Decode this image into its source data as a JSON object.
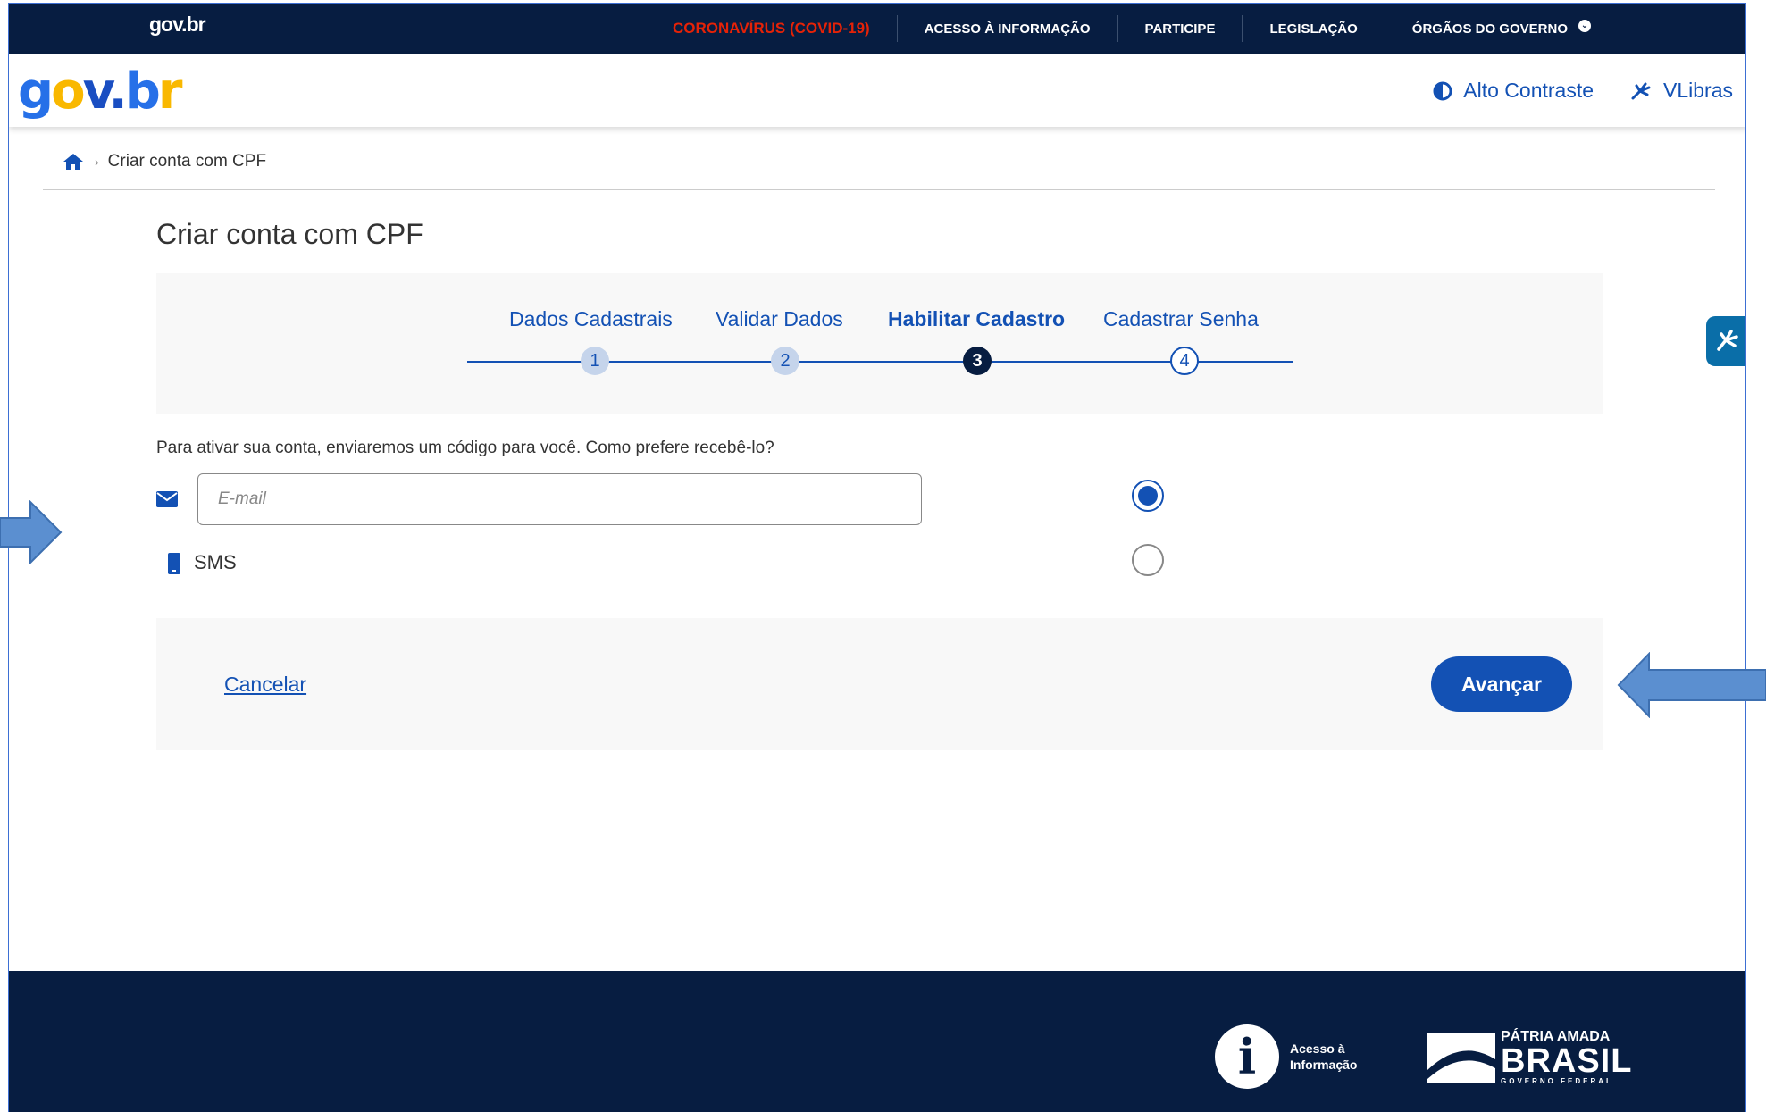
{
  "topbar": {
    "brand": "gov.br",
    "nav": [
      "CORONAVÍRUS (COVID-19)",
      "ACESSO À INFORMAÇÃO",
      "PARTICIPE",
      "LEGISLAÇÃO",
      "ÓRGÃOS DO GOVERNO"
    ]
  },
  "header": {
    "logo": "gov.br",
    "high_contrast": "Alto Contraste",
    "vlibras": "VLibras"
  },
  "breadcrumb": {
    "current": "Criar conta com CPF"
  },
  "page": {
    "title": "Criar conta com CPF",
    "steps": [
      {
        "label": "Dados Cadastrais",
        "number": "1",
        "state": "done"
      },
      {
        "label": "Validar Dados",
        "number": "2",
        "state": "done"
      },
      {
        "label": "Habilitar Cadastro",
        "number": "3",
        "state": "current"
      },
      {
        "label": "Cadastrar Senha",
        "number": "4",
        "state": "todo"
      }
    ],
    "question": "Para ativar sua conta, enviaremos um código para você. Como prefere recebê-lo?",
    "email_placeholder": "E-mail",
    "sms_label": "SMS",
    "selected_option": "email"
  },
  "actions": {
    "cancel": "Cancelar",
    "advance": "Avançar"
  },
  "footer": {
    "info_line1": "Acesso à",
    "info_line2": "Informação",
    "brasil_line1": "PÁTRIA AMADA",
    "brasil_line2": "BRASIL",
    "brasil_line3": "GOVERNO FEDERAL"
  },
  "colors": {
    "navy": "#071d41",
    "primary": "#1351b4",
    "alert": "#e52207",
    "annotation_arrow": "#5b8fd0"
  }
}
